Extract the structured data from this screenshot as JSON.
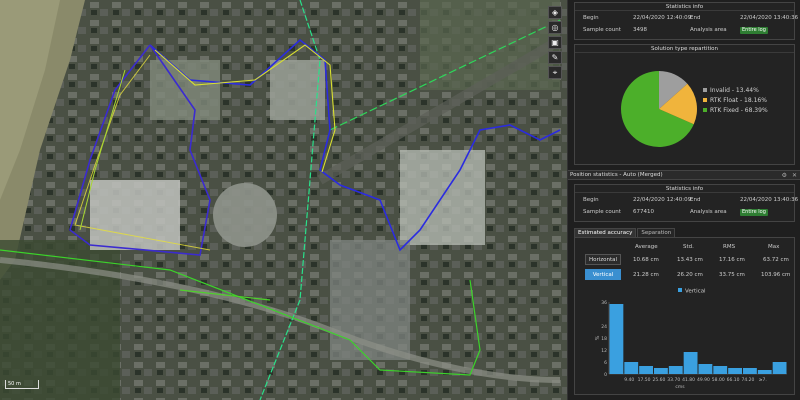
{
  "map": {
    "tools": [
      {
        "icon": "layers-icon",
        "glyph": "◈"
      },
      {
        "icon": "locate-icon",
        "glyph": "◎"
      },
      {
        "icon": "camera-icon",
        "glyph": "▣"
      },
      {
        "icon": "ruler-icon",
        "glyph": "✎"
      },
      {
        "icon": "marker-icon",
        "glyph": "⌖"
      }
    ],
    "scale_label": "50 m"
  },
  "stats_top": {
    "title": "Statistics info",
    "begin_label": "Begin",
    "begin_value": "22/04/2020 12:40:09",
    "end_label": "End",
    "end_value": "22/04/2020 13:40:36",
    "count_label": "Sample count",
    "count_value": "3498",
    "area_label": "Analysis area",
    "area_value": "Entire log"
  },
  "solution": {
    "title": "Solution type repartition",
    "colors": {
      "invalid": "#9e9e9e",
      "float": "#f0b43c",
      "fixed": "#4caf2a"
    },
    "legend": [
      "Invalid - 13.44%",
      "RTK Float - 18.16%",
      "RTK Fixed - 68.39%"
    ]
  },
  "pane": {
    "title": "Position statistics - Auto (Merged)",
    "icons": [
      "gear-icon",
      "close-icon"
    ]
  },
  "stats_bottom": {
    "title": "Statistics info",
    "begin_label": "Begin",
    "begin_value": "22/04/2020 12:40:09",
    "end_label": "End",
    "end_value": "22/04/2020 13:40:36",
    "count_label": "Sample count",
    "count_value": "677410",
    "area_label": "Analysis area",
    "area_value": "Entire log"
  },
  "tabs": [
    "Estimated accuracy",
    "Separation"
  ],
  "accuracy": {
    "headers": [
      "Average",
      "Std.",
      "RMS",
      "Max"
    ],
    "rows": [
      {
        "label": "Horizontal",
        "values": [
          "10.68 cm",
          "13.43 cm",
          "17.16 cm",
          "63.72 cm"
        ]
      },
      {
        "label": "Vertical",
        "values": [
          "21.28 cm",
          "26.20 cm",
          "33.75 cm",
          "103.96 cm"
        ]
      }
    ]
  },
  "chart_data": {
    "type": "bar",
    "legend": "Vertical",
    "color": "#3aa0e0",
    "ylabel": "%",
    "xlabel": "cms",
    "y_ticks": [
      "36",
      "24",
      "18",
      "12",
      "6",
      "0"
    ],
    "ylim": [
      0,
      36
    ],
    "x_tick_labels": [
      "9.40",
      "17.50",
      "25.60",
      "33.70",
      "41.80",
      "49.90",
      "58.00",
      "66.10",
      "74.20",
      "≥7."
    ],
    "values": [
      35,
      6,
      4,
      3,
      4,
      11,
      5,
      4,
      3,
      3,
      2,
      6
    ]
  }
}
